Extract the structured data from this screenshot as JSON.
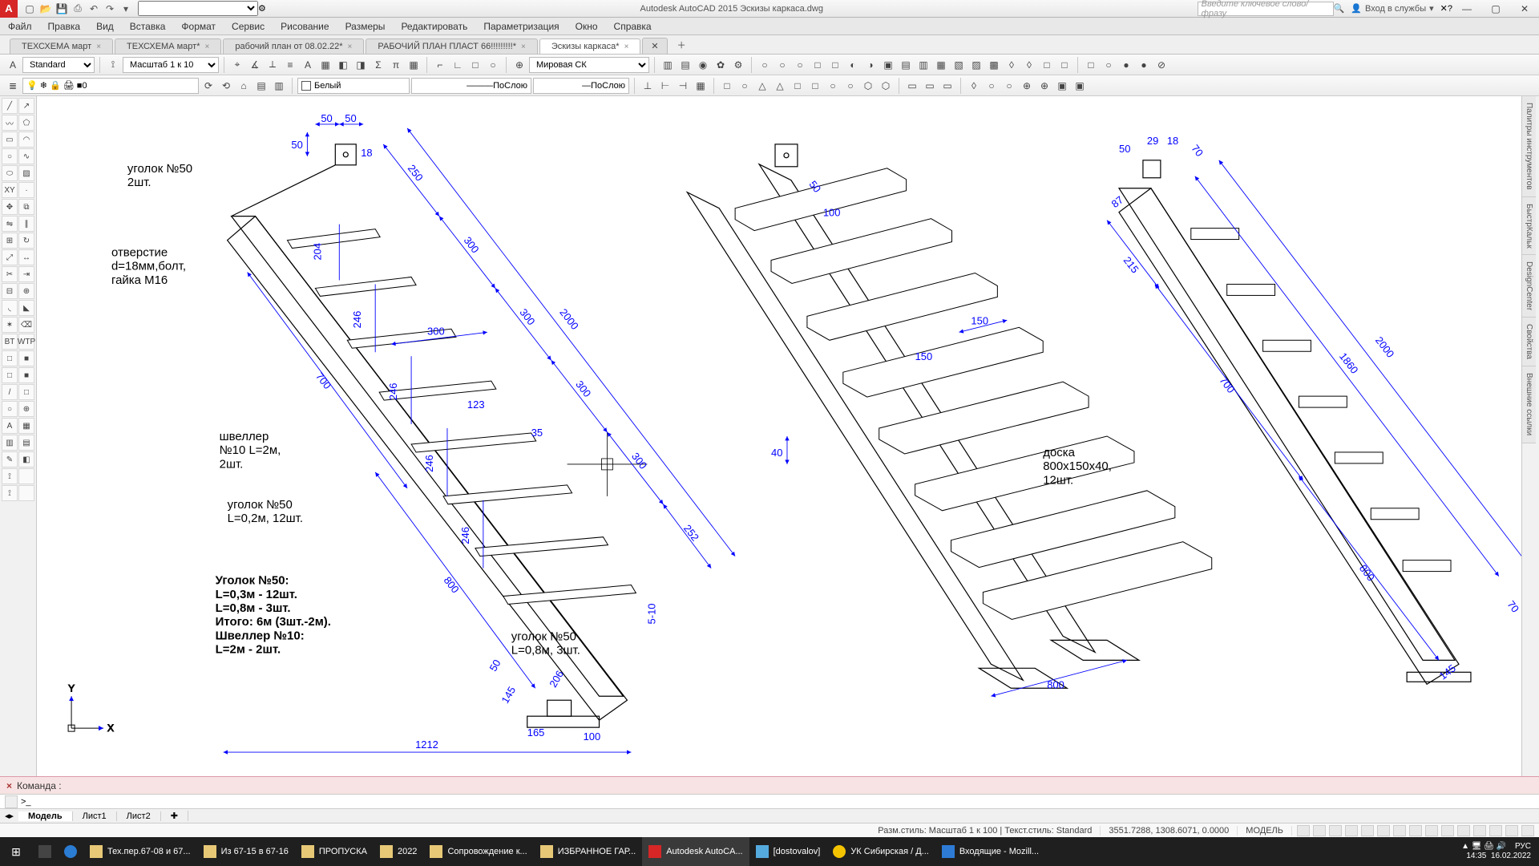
{
  "app": {
    "title": "Autodesk AutoCAD 2015   Эскизы каркаса.dwg",
    "search_placeholder": "Введите ключевое слово/фразу",
    "login": "Вход в службы",
    "qat_icons": [
      "new-icon",
      "open-icon",
      "save-icon",
      "saveas-icon",
      "print-icon",
      "undo-icon",
      "redo-icon"
    ]
  },
  "menu": [
    "Файл",
    "Правка",
    "Вид",
    "Вставка",
    "Формат",
    "Сервис",
    "Рисование",
    "Размеры",
    "Редактировать",
    "Параметризация",
    "Окно",
    "Справка"
  ],
  "file_tabs": [
    {
      "label": "ТЕХСХЕМА март",
      "active": false
    },
    {
      "label": "ТЕХСХЕМА март*",
      "active": false
    },
    {
      "label": "рабочий план от 08.02.22*",
      "active": false
    },
    {
      "label": "РАБОЧИЙ ПЛАН ПЛАСТ 66!!!!!!!!!*",
      "active": false
    },
    {
      "label": "Эскизы каркаса*",
      "active": true
    }
  ],
  "toolbar1": {
    "text_style": "Standard",
    "dim_style": "Масштаб 1 к 10",
    "coord_sys": "Мировая СК"
  },
  "toolbar2": {
    "layer_dropdown": "0",
    "color": "Белый",
    "linetype": "ПоСлою",
    "lineweight": "ПоСлою"
  },
  "right_tabs": [
    "Палитры инструментов",
    "БыстрКальк",
    "DesignCenter",
    "Свойства",
    "Внешние ссылки"
  ],
  "drawing": {
    "labels": {
      "corner50_2": "уголок №50\n2шт.",
      "hole": "отверстие\nd=18мм,болт,\nгайка М16",
      "channel": "швеллер\n№10 L=2м,\n2шт.",
      "corner50_12": "уголок №50\nL=0,2м, 12шт.",
      "corner50_long": "уголок №50\nL=0,8м, 3шт.",
      "board": "доска\n800х150х40,\n12шт.",
      "summary": "Уголок №50:\nL=0,3м - 12шт.\nL=0,8м - 3шт.\nИтого: 6м (3шт.-2м).\nШвеллер №10:\nL=2м - 2шт."
    },
    "dims": {
      "d50a": "50",
      "d50b": "50",
      "d50c": "50",
      "d18": "18",
      "d250": "250",
      "d300": "300",
      "d2000": "2000",
      "d204": "204",
      "d246": "246",
      "d246b": "246",
      "d246c": "246",
      "d246d": "246",
      "d123": "123",
      "d35": "35",
      "d700": "700",
      "d800": "800",
      "d252": "252",
      "d165": "165",
      "d100": "100",
      "d206": "206",
      "d1212": "1212",
      "d50d": "50",
      "d145": "145",
      "d5_10": "5-10",
      "mid_50": "50",
      "mid_100": "100",
      "mid_150": "150",
      "mid_40": "40",
      "mid_800": "800",
      "r_50": "50",
      "r_29": "29",
      "r_18": "18",
      "r_70a": "70",
      "r_70b": "70",
      "r_215": "215",
      "r_700": "700",
      "r_800": "800",
      "r_1860": "1860",
      "r_2000": "2000",
      "r_145": "145",
      "r_87": "87"
    },
    "ucs": {
      "x": "X",
      "y": "Y"
    }
  },
  "command": {
    "label": "Команда :",
    "prompt": ">_"
  },
  "layout_tabs": [
    "Модель",
    "Лист1",
    "Лист2"
  ],
  "status": {
    "dimstyle": "Разм.стиль: Масштаб 1 к 100 | Текст.стиль: Standard",
    "coords": "3551.7288, 1308.6071, 0.0000",
    "space": "МОДЕЛЬ"
  },
  "taskbar": {
    "items": [
      {
        "label": "",
        "icon": "start"
      },
      {
        "label": "",
        "icon": "calc"
      },
      {
        "label": "",
        "icon": "edge"
      },
      {
        "label": "Тех.пер.67-08 и 67...",
        "icon": "folder"
      },
      {
        "label": "Из 67-15 в 67-16",
        "icon": "folder"
      },
      {
        "label": "ПРОПУСКА",
        "icon": "folder"
      },
      {
        "label": "2022",
        "icon": "folder"
      },
      {
        "label": "Сопровождение к...",
        "icon": "folder"
      },
      {
        "label": "ИЗБРАННОЕ ГАР...",
        "icon": "folder"
      },
      {
        "label": "Autodesk AutoCA...",
        "icon": "acad",
        "active": true
      },
      {
        "label": "[dostovalov]",
        "icon": "app"
      },
      {
        "label": "УК Сибирская / Д...",
        "icon": "1c"
      },
      {
        "label": "Входящие - Mozill...",
        "icon": "tb"
      }
    ],
    "lang": "РУС",
    "time": "14:35",
    "date": "16.02.2022"
  }
}
